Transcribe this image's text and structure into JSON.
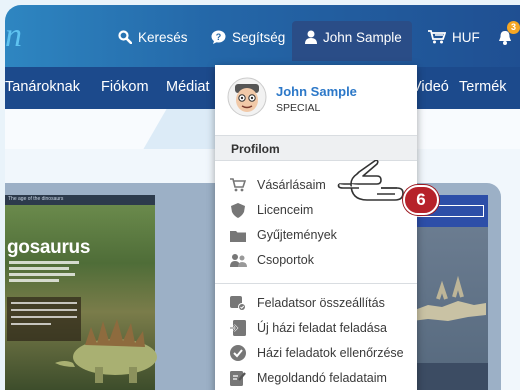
{
  "topbar": {
    "search_label": "Keresés",
    "help_label": "Segítség",
    "user_label": "John Sample",
    "currency_label": "HUF",
    "notification_count": "3"
  },
  "nav": {
    "items": [
      "Tanároknak",
      "Fiókom",
      "Médiat",
      "Videó",
      "Termék"
    ]
  },
  "book": {
    "header_text": "The age of the dinosaurs",
    "title": "gosaurus"
  },
  "user_menu": {
    "name": "John Sample",
    "role": "SPECIAL",
    "section_title": "Profilom",
    "profile_items": [
      "Vásárlásaim",
      "Licenceim",
      "Gyűjtemények",
      "Csoportok"
    ],
    "task_items": [
      "Feladatsor összeállítás",
      "Új házi feladat feladása",
      "Házi feladatok ellenőrzése",
      "Megoldandó feladataim"
    ]
  },
  "callout": {
    "number": "6"
  },
  "colors": {
    "topbar_start": "#2e86c1",
    "nav": "#1c4a8c",
    "link_blue": "#2c78c8",
    "callout_red": "#b6222a",
    "badge_orange": "#f5a623"
  },
  "icons": {
    "search": "search-icon",
    "help": "help-icon",
    "user": "user-icon",
    "cart": "cart-icon",
    "bell": "bell-icon"
  }
}
